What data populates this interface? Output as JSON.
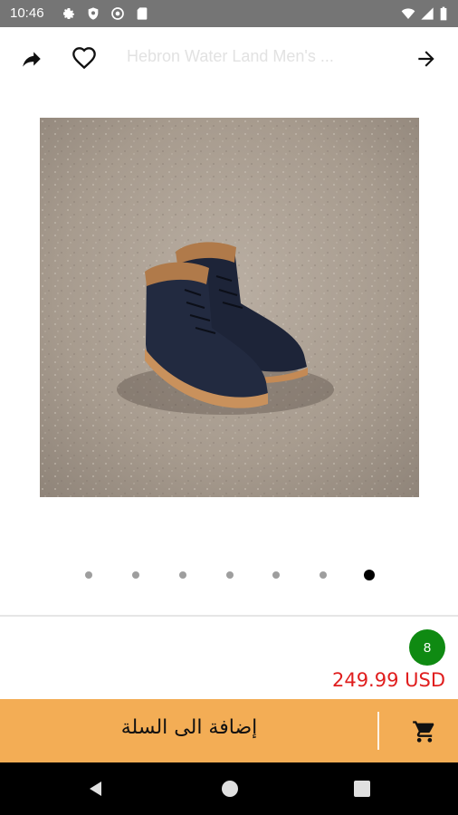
{
  "status_bar": {
    "time": "10:46",
    "icons": [
      "gear-icon",
      "shield-icon",
      "sync-icon",
      "sd-card-icon",
      "wifi-icon",
      "signal-icon",
      "battery-icon"
    ]
  },
  "app_bar": {
    "title": "Hebron Water Land Men's ...",
    "share_icon": "share-icon",
    "favorite_icon": "heart-outline-icon",
    "back_icon": "arrow-right-icon"
  },
  "product": {
    "image": "brown-leather-boots-photo",
    "slides_total": 7,
    "slide_active": 7
  },
  "stock_count": "8",
  "price": "249.99 USD",
  "cart": {
    "label": "إضافة الى السلة",
    "icon": "shopping-cart-icon"
  },
  "colors": {
    "status_bar": "#757575",
    "cart_bar": "#f3ad55",
    "price": "#e01e1e",
    "stock_badge": "#0f8a12"
  },
  "nav_bar": {
    "icons": [
      "back-triangle-icon",
      "home-circle-icon",
      "recents-square-icon"
    ]
  }
}
